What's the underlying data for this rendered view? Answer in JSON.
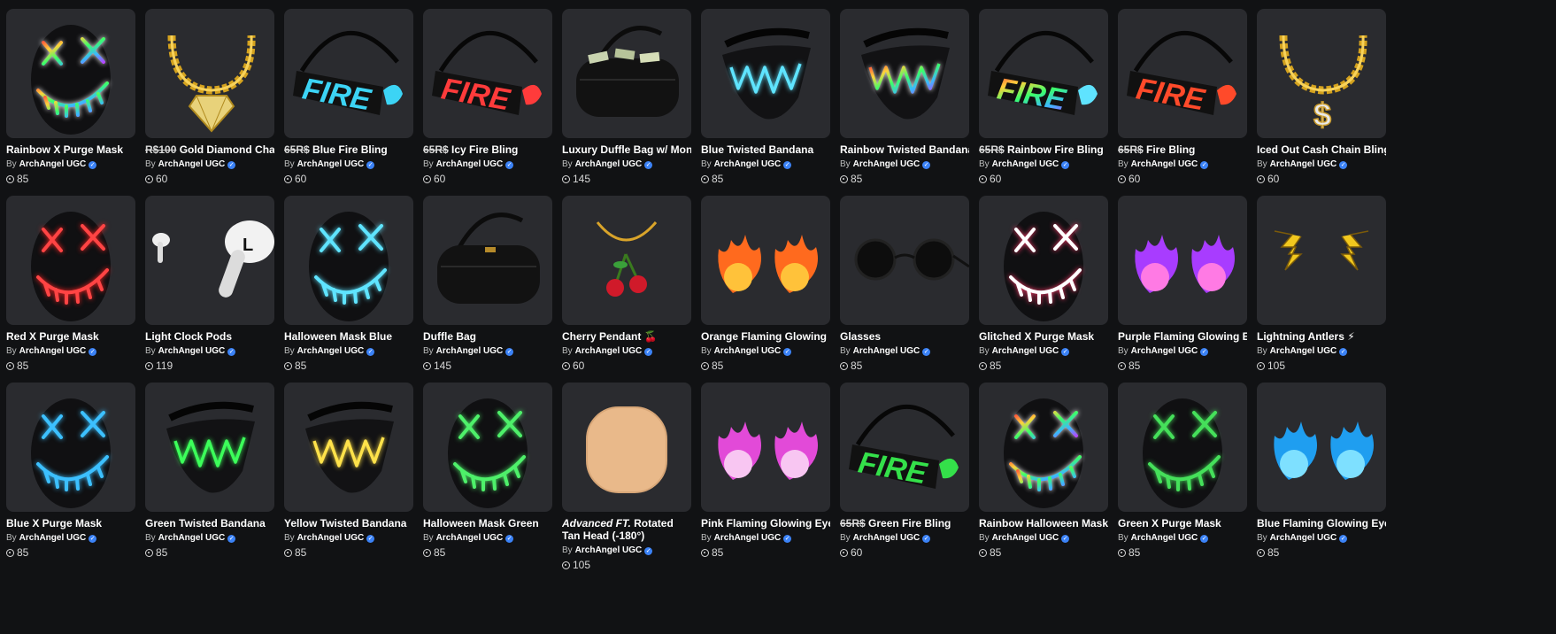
{
  "catalog": {
    "by_prefix": "By",
    "items": [
      {
        "name": "Rainbow X Purge Mask",
        "creator": "ArchAngel UGC",
        "price": "85",
        "icon": "rainbow-purge-mask-icon"
      },
      {
        "name_strike": "R$100",
        "name": " Gold Diamond Chain Bling",
        "creator": "ArchAngel UGC",
        "price": "60",
        "icon": "gold-diamond-chain-icon"
      },
      {
        "name_strike": "65R$",
        "name": " Blue Fire Bling",
        "creator": "ArchAngel UGC",
        "price": "60",
        "icon": "blue-fire-bling-icon"
      },
      {
        "name_strike": "65R$",
        "name": " Icy Fire Bling",
        "creator": "ArchAngel UGC",
        "price": "60",
        "icon": "icy-fire-bling-icon"
      },
      {
        "name": "Luxury Duffle Bag w/ Money",
        "creator": "ArchAngel UGC",
        "price": "145",
        "icon": "money-duffle-bag-icon"
      },
      {
        "name": "Blue Twisted Bandana",
        "creator": "ArchAngel UGC",
        "price": "85",
        "icon": "blue-bandana-icon"
      },
      {
        "name": "Rainbow Twisted Bandana",
        "creator": "ArchAngel UGC",
        "price": "85",
        "icon": "rainbow-bandana-icon"
      },
      {
        "name_strike": "65R$",
        "name": " Rainbow Fire Bling",
        "creator": "ArchAngel UGC",
        "price": "60",
        "icon": "rainbow-fire-bling-icon"
      },
      {
        "name_strike": "65R$",
        "name": " Fire Bling",
        "creator": "ArchAngel UGC",
        "price": "60",
        "icon": "fire-bling-icon"
      },
      {
        "name": "Iced Out Cash Chain Bling",
        "creator": "ArchAngel UGC",
        "price": "60",
        "icon": "cash-chain-icon"
      },
      {
        "name": "Red X Purge Mask",
        "creator": "ArchAngel UGC",
        "price": "85",
        "icon": "red-purge-mask-icon"
      },
      {
        "name": "Light Clock Pods",
        "creator": "ArchAngel UGC",
        "price": "119",
        "icon": "earbuds-icon"
      },
      {
        "name": "Halloween Mask Blue",
        "creator": "ArchAngel UGC",
        "price": "85",
        "icon": "blue-halloween-mask-icon"
      },
      {
        "name": "Duffle Bag",
        "creator": "ArchAngel UGC",
        "price": "145",
        "icon": "duffle-bag-icon"
      },
      {
        "name": "Cherry Pendant 🍒",
        "creator": "ArchAngel UGC",
        "price": "60",
        "icon": "cherry-pendant-icon"
      },
      {
        "name": "Orange Flaming Glowing Eyes",
        "creator": "ArchAngel UGC",
        "price": "85",
        "icon": "orange-flaming-eyes-icon"
      },
      {
        "name": "Glasses",
        "creator": "ArchAngel UGC",
        "price": "85",
        "icon": "glasses-icon"
      },
      {
        "name": "Glitched X Purge Mask",
        "creator": "ArchAngel UGC",
        "price": "85",
        "icon": "glitched-purge-mask-icon"
      },
      {
        "name": "Purple Flaming Glowing Eyes",
        "creator": "ArchAngel UGC",
        "price": "85",
        "icon": "purple-flaming-eyes-icon"
      },
      {
        "name": "Lightning Antlers ⚡",
        "creator": "ArchAngel UGC",
        "price": "105",
        "icon": "lightning-antlers-icon"
      },
      {
        "name": "Blue X Purge Mask",
        "creator": "ArchAngel UGC",
        "price": "85",
        "icon": "blue-purge-mask-icon"
      },
      {
        "name": "Green Twisted Bandana",
        "creator": "ArchAngel UGC",
        "price": "85",
        "icon": "green-bandana-icon"
      },
      {
        "name": "Yellow Twisted Bandana",
        "creator": "ArchAngel UGC",
        "price": "85",
        "icon": "yellow-bandana-icon"
      },
      {
        "name": "Halloween Mask Green",
        "creator": "ArchAngel UGC",
        "price": "85",
        "icon": "green-halloween-mask-icon"
      },
      {
        "name_em": "Advanced FT.",
        "name": " Rotated Tan Head (-180°)",
        "creator": "ArchAngel UGC",
        "price": "105",
        "icon": "tan-head-icon"
      },
      {
        "name": "Pink Flaming Glowing Eyes",
        "creator": "ArchAngel UGC",
        "price": "85",
        "icon": "pink-flaming-eyes-icon"
      },
      {
        "name_strike": "65R$",
        "name": " Green Fire Bling",
        "creator": "ArchAngel UGC",
        "price": "60",
        "icon": "green-fire-bling-icon"
      },
      {
        "name": "Rainbow Halloween Mask",
        "creator": "ArchAngel UGC",
        "price": "85",
        "icon": "rainbow-halloween-mask-icon"
      },
      {
        "name": "Green X Purge Mask",
        "creator": "ArchAngel UGC",
        "price": "85",
        "icon": "green-purge-mask-icon"
      },
      {
        "name": "Blue Flaming Glowing Eyes",
        "creator": "ArchAngel UGC",
        "price": "85",
        "icon": "blue-flaming-eyes-icon"
      }
    ]
  }
}
